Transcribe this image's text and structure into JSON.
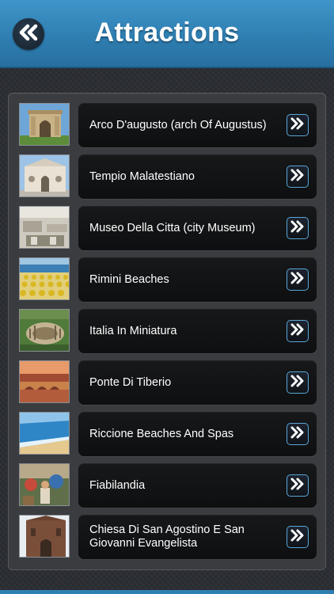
{
  "header": {
    "title": "Attractions",
    "back_icon": "double-chevron-left-icon",
    "color": "#2f7fb2"
  },
  "list": {
    "arrow_icon": "double-chevron-right-icon",
    "items": [
      {
        "label": "Arco D'augusto (arch Of Augustus)"
      },
      {
        "label": "Tempio Malatestiano"
      },
      {
        "label": "Museo Della Citta (city Museum)"
      },
      {
        "label": "Rimini Beaches"
      },
      {
        "label": "Italia In Miniatura"
      },
      {
        "label": "Ponte Di Tiberio"
      },
      {
        "label": "Riccione Beaches And Spas"
      },
      {
        "label": "Fiabilandia"
      },
      {
        "label": "Chiesa Di San Agostino E San Giovanni Evangelista"
      }
    ]
  }
}
